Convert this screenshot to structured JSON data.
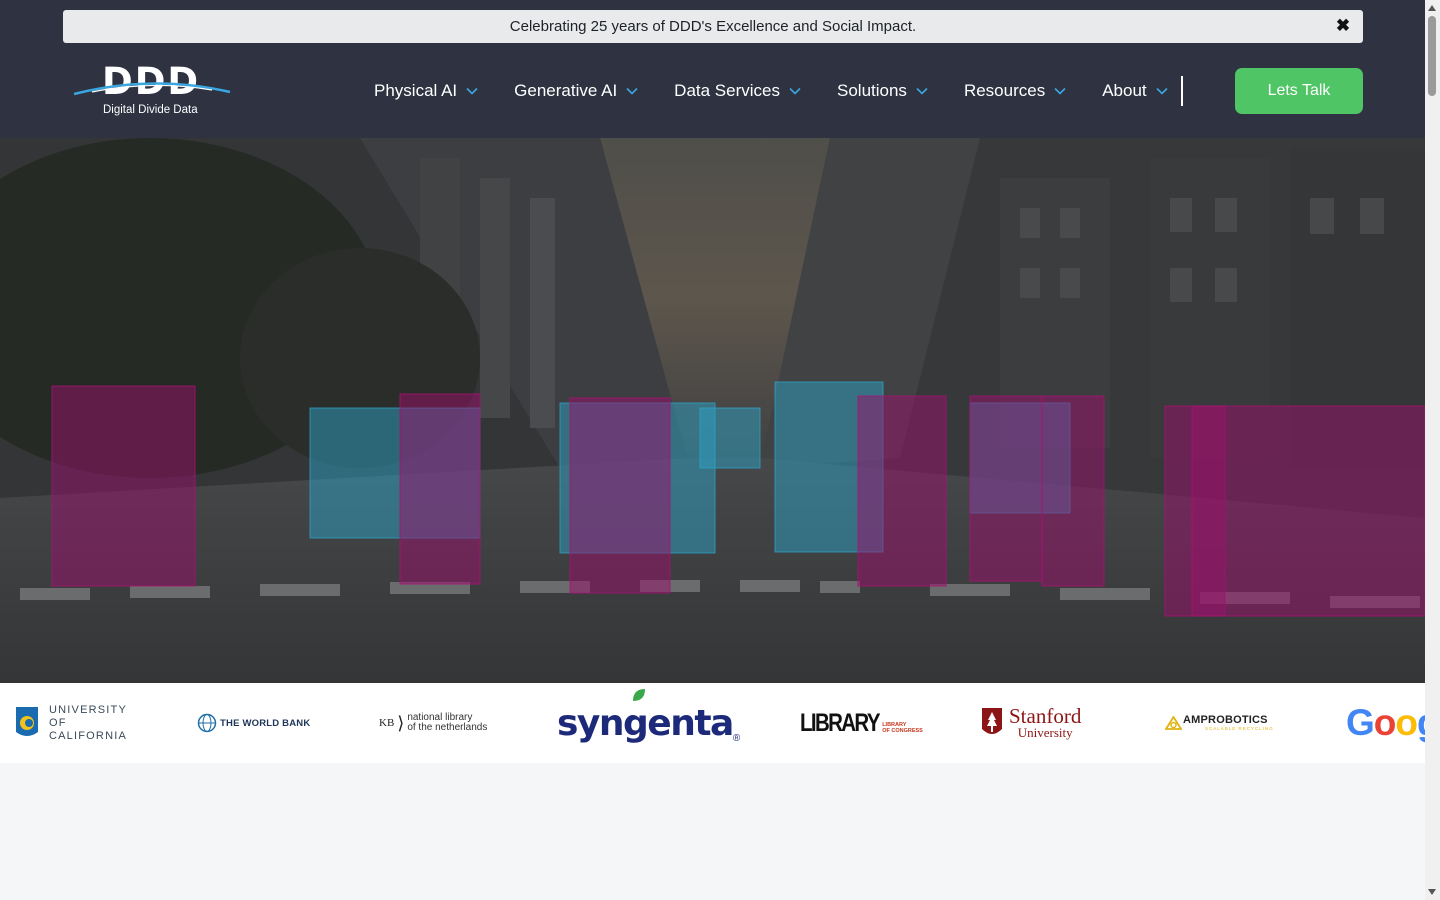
{
  "announcement": {
    "text": "Celebrating 25 years of DDD's Excellence and Social Impact.",
    "close_glyph": "✖"
  },
  "logo": {
    "mark": "DDD",
    "subtitle": "Digital Divide Data"
  },
  "nav": {
    "items": [
      {
        "label": "Physical AI"
      },
      {
        "label": "Generative AI"
      },
      {
        "label": "Data Services"
      },
      {
        "label": "Solutions"
      },
      {
        "label": "Resources"
      },
      {
        "label": "About"
      }
    ],
    "cta_label": "Lets Talk"
  },
  "clients": {
    "uc": {
      "line1": "UNIVERSITY",
      "line2": "OF",
      "line3": "CALIFORNIA"
    },
    "world_bank": "THE WORLD BANK",
    "kb": {
      "mark": "KB",
      "line1": "national library",
      "line2": "of the netherlands"
    },
    "syngenta": "syngenta",
    "loc": {
      "main": "LIBRARY",
      "sub1": "LIBRARY",
      "sub2": "OF CONGRESS"
    },
    "stanford": {
      "line1": "Stanford",
      "line2": "University"
    },
    "amp": {
      "main": "AMPROBOTICS",
      "sub": "SCALABLE RECYCLING"
    },
    "google": "Goog"
  },
  "colors": {
    "header_bg": "#2e3241",
    "accent_green": "#4fc565",
    "chevron_blue": "#3aa6e0",
    "box_cyan": "#33b7e0",
    "box_magenta": "#b0127a"
  }
}
